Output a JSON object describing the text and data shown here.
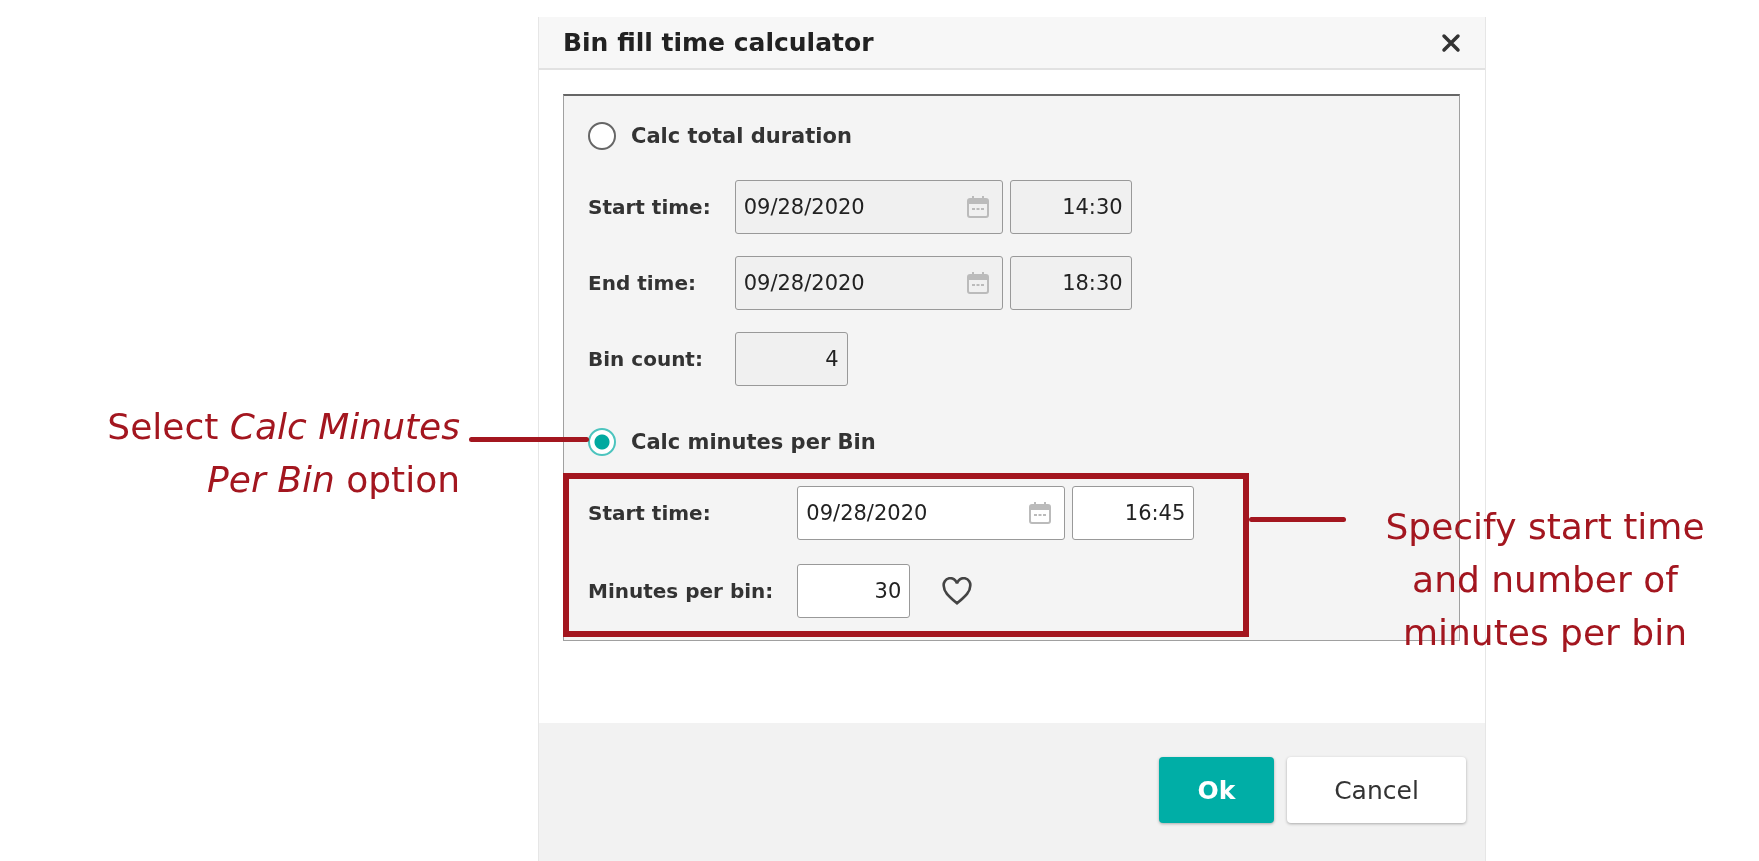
{
  "dialog": {
    "title": "Bin fill time calculator",
    "options": [
      {
        "label": "Calc total duration",
        "selected": false,
        "fields": [
          {
            "kind": "datetime",
            "label": "Start time:",
            "date": "09/28/2020",
            "time": "14:30"
          },
          {
            "kind": "datetime",
            "label": "End time:",
            "date": "09/28/2020",
            "time": "18:30"
          },
          {
            "kind": "number",
            "label": "Bin count:",
            "value": "4"
          }
        ]
      },
      {
        "label": "Calc minutes per Bin",
        "selected": true,
        "fields": [
          {
            "kind": "datetime",
            "label": "Start time:",
            "date": "09/28/2020",
            "time": "16:45"
          },
          {
            "kind": "number_favorite",
            "label": "Minutes per bin:",
            "value": "30"
          }
        ]
      }
    ],
    "buttons": [
      {
        "label": "Ok",
        "kind": "primary"
      },
      {
        "label": "Cancel",
        "kind": "secondary"
      }
    ]
  },
  "annotations": [
    {
      "kind": "left_note",
      "text": "Select *Calc Minutes Per Bin* option"
    },
    {
      "kind": "right_note",
      "text": "Specify start time and number of minutes per bin"
    }
  ]
}
